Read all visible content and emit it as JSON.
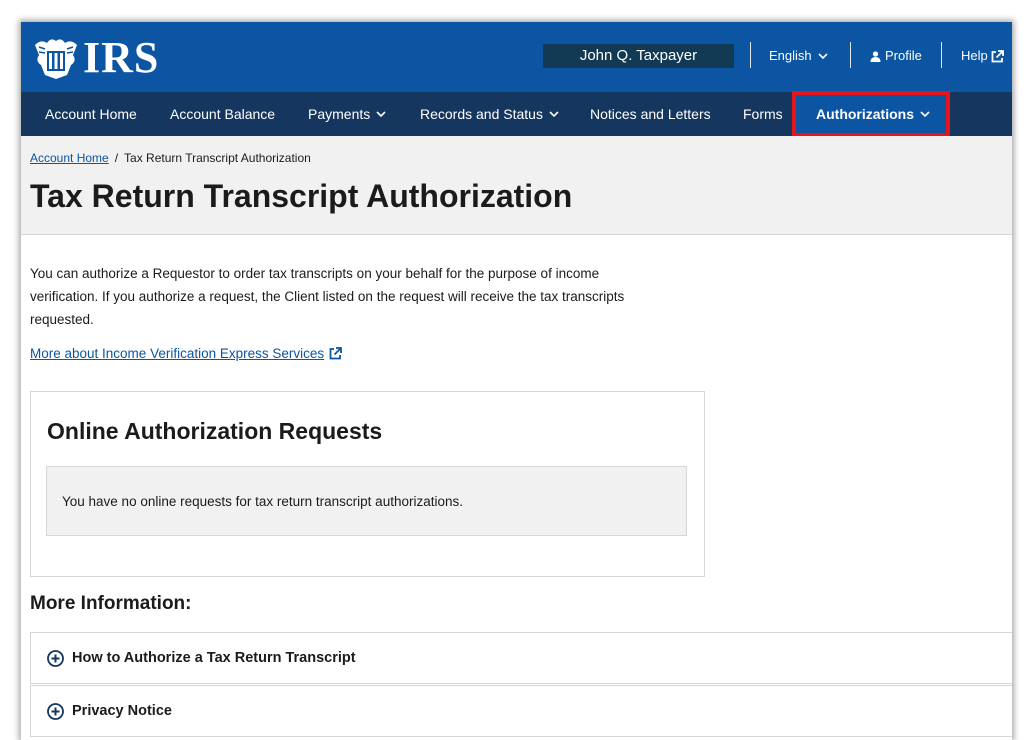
{
  "header": {
    "logo_text": "IRS",
    "user_name": "John Q. Taxpayer",
    "language": "English",
    "profile": "Profile",
    "help": "Help"
  },
  "nav": {
    "items": [
      {
        "label": "Account Home"
      },
      {
        "label": "Account Balance"
      },
      {
        "label": "Payments"
      },
      {
        "label": "Records and Status"
      },
      {
        "label": "Notices and Letters"
      },
      {
        "label": "Forms"
      },
      {
        "label": "Authorizations"
      }
    ],
    "active": "Authorizations"
  },
  "breadcrumb": {
    "home": "Account Home",
    "separator": "/",
    "current": "Tax Return Transcript Authorization"
  },
  "page": {
    "title": "Tax Return Transcript Authorization",
    "intro": "You can authorize a Requestor to order tax transcripts on your behalf for the purpose of income verification. If you authorize a request, the Client listed on the request will receive the tax transcripts requested.",
    "more_link": "More about Income Verification Express Services"
  },
  "requests_card": {
    "title": "Online Authorization Requests",
    "empty_message": "You have no online requests for tax return transcript authorizations."
  },
  "more_info": {
    "title": "More Information:",
    "items": [
      {
        "label": "How to Authorize a Tax Return Transcript"
      },
      {
        "label": "Privacy Notice"
      }
    ]
  },
  "colors": {
    "header_blue": "#0b55a3",
    "nav_navy": "#14365f",
    "user_box": "#123a54",
    "highlight_red": "#e8141b"
  }
}
